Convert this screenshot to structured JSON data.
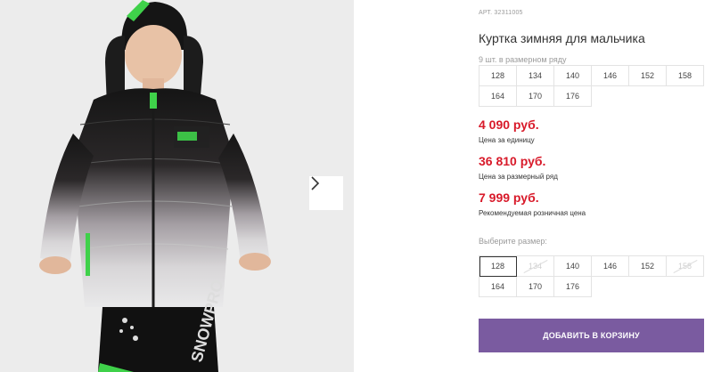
{
  "product": {
    "sku": "АРТ. 32311005",
    "title": "Куртка зимняя для мальчика",
    "pack_note": "9 шт. в размерном ряду",
    "pack_sizes": [
      "128",
      "134",
      "140",
      "146",
      "152",
      "158",
      "164",
      "170",
      "176"
    ],
    "price_unit": "4 090 руб.",
    "price_unit_label": "Цена за единицу",
    "price_pack": "36 810 руб.",
    "price_pack_label": "Цена за размерный ряд",
    "price_retail": "7 999 руб.",
    "price_retail_label": "Рекомендуемая розничная цена",
    "choose_size_label": "Выберите размер:",
    "size_options": [
      {
        "label": "128",
        "state": "selected"
      },
      {
        "label": "134",
        "state": "disabled"
      },
      {
        "label": "140",
        "state": "available"
      },
      {
        "label": "146",
        "state": "available"
      },
      {
        "label": "152",
        "state": "available"
      },
      {
        "label": "158",
        "state": "disabled"
      },
      {
        "label": "164",
        "state": "available"
      },
      {
        "label": "170",
        "state": "available"
      },
      {
        "label": "176",
        "state": "available"
      }
    ],
    "add_to_cart": "ДОБАВИТЬ В КОРЗИНУ"
  },
  "gallery": {
    "next_icon": "chevron-right-icon",
    "image": "boy-in-gradient-winter-jacket",
    "pants_print": "SNOWPRO"
  },
  "colors": {
    "price": "#d81a2a",
    "button": "#7a5ba0",
    "accent_green": "#3fd14a"
  }
}
